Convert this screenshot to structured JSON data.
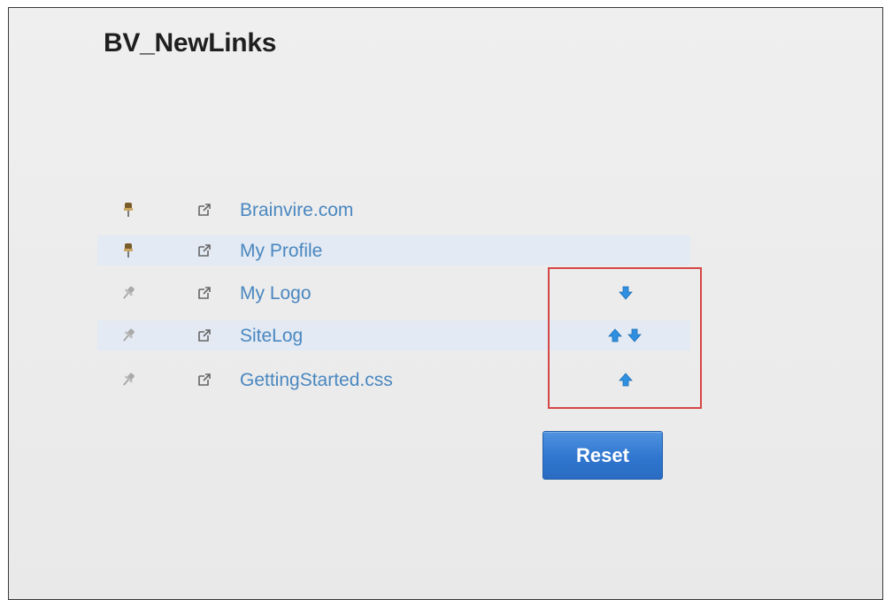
{
  "page": {
    "title": "BV_NewLinks"
  },
  "links": [
    {
      "label": "Brainvire.com",
      "pinned": true
    },
    {
      "label": "My Profile",
      "pinned": true
    },
    {
      "label": "My Logo",
      "pinned": false,
      "move_down": true
    },
    {
      "label": "SiteLog",
      "pinned": false,
      "move_up": true,
      "move_down": true
    },
    {
      "label": "GettingStarted.css",
      "pinned": false,
      "move_up": true
    }
  ],
  "icons": {
    "pinned": "pin-icon",
    "unpinned": "unpin-icon",
    "external": "external-link-icon",
    "up": "arrow-up-icon",
    "down": "arrow-down-icon"
  },
  "buttons": {
    "reset_label": "Reset"
  },
  "colors": {
    "link": "#4a87c0",
    "arrow": "#2f8fe0",
    "button": "#2f76cf",
    "highlight": "#d64646",
    "alt_row": "#e3eaf3"
  }
}
